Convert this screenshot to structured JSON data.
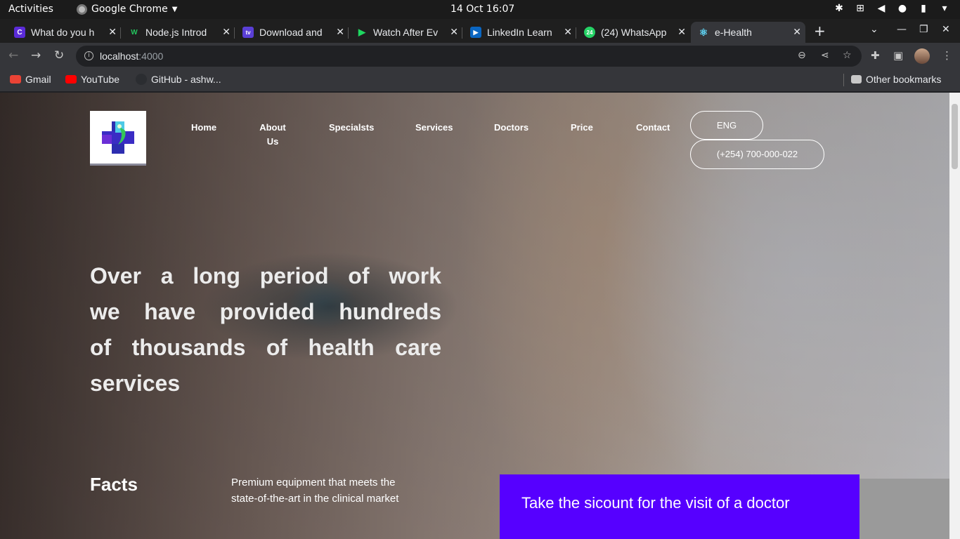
{
  "system": {
    "activities": "Activities",
    "app_name": "Google Chrome",
    "clock": "14 Oct  16:07"
  },
  "tabs": [
    {
      "title": "What do you h",
      "favicon_color": "#5b2bd8",
      "favicon": "C"
    },
    {
      "title": "Node.js Introd",
      "favicon_color": "#1f1f1f",
      "favicon": "W"
    },
    {
      "title": "Download and",
      "favicon_color": "#5a3fd6",
      "favicon": "tv"
    },
    {
      "title": "Watch After Ev",
      "favicon_color": "#1f1f1f",
      "favicon": "▶"
    },
    {
      "title": "LinkedIn Learn",
      "favicon_color": "#0a66c2",
      "favicon": "▶"
    },
    {
      "title": "(24) WhatsApp",
      "favicon_color": "#25d366",
      "favicon": "24"
    },
    {
      "title": "e-Health",
      "favicon_color": "#35363a",
      "favicon": "⚛"
    }
  ],
  "address_bar": {
    "host": "localhost",
    "port": ":4000"
  },
  "bookmarks": [
    {
      "label": "Gmail",
      "color": "#ea4335"
    },
    {
      "label": "YouTube",
      "color": "#ff0000"
    },
    {
      "label": "GitHub - ashw...",
      "color": "#24292e"
    }
  ],
  "other_bookmarks": "Other bookmarks",
  "site": {
    "nav": [
      "Home",
      "About Us",
      "Specialsts",
      "Services",
      "Doctors",
      "Price",
      "Contact"
    ],
    "language": "ENG",
    "phone": "(+254) 700-000-022",
    "headline": "Over a long period of work we have provided hundreds of thousands of health care services",
    "facts_title": "Facts",
    "facts_text": "Premium equipment that meets the state-of-the-art in the clinical market",
    "promo": "Take the sicount for the visit of a doctor",
    "accent_color": "#5600ff"
  }
}
